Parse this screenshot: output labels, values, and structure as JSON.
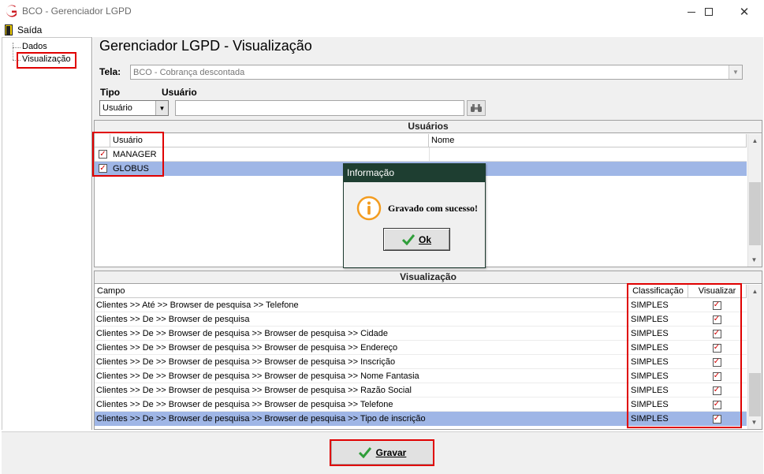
{
  "window": {
    "title": "BCO - Gerenciador LGPD",
    "minimize": "—",
    "maximize": "☐",
    "close": "✕"
  },
  "menu": {
    "exit_label": "Saída"
  },
  "tree": {
    "items": [
      {
        "label": "Dados"
      },
      {
        "label": "Visualização"
      }
    ]
  },
  "page": {
    "title": "Gerenciador LGPD - Visualização"
  },
  "form": {
    "tela_label": "Tela:",
    "tela_value": "BCO - Cobrança descontada",
    "tipo_label": "Tipo",
    "tipo_value": "Usuário",
    "usuario_label": "Usuário",
    "usuario_value": ""
  },
  "users_section": {
    "header": "Usuários",
    "columns": [
      "Usuário",
      "Nome"
    ],
    "rows": [
      {
        "usuario": "MANAGER",
        "nome": "",
        "checked": true,
        "selected": false
      },
      {
        "usuario": "GLOBUS",
        "nome": "",
        "checked": true,
        "selected": true
      }
    ]
  },
  "vis_section": {
    "header": "Visualização",
    "columns": [
      "Campo",
      "Classificação",
      "Visualizar"
    ],
    "rows": [
      {
        "campo": "Clientes >> Até  >> Browser de pesquisa >> Telefone",
        "classificacao": "SIMPLES",
        "visualizar": true
      },
      {
        "campo": "Clientes >> De >> Browser de pesquisa",
        "classificacao": "SIMPLES",
        "visualizar": true
      },
      {
        "campo": "Clientes >> De >> Browser de pesquisa >> Browser de pesquisa >> Cidade",
        "classificacao": "SIMPLES",
        "visualizar": true
      },
      {
        "campo": "Clientes >> De >> Browser de pesquisa >> Browser de pesquisa >> Endereço",
        "classificacao": "SIMPLES",
        "visualizar": true
      },
      {
        "campo": "Clientes >> De >> Browser de pesquisa >> Browser de pesquisa >> Inscrição",
        "classificacao": "SIMPLES",
        "visualizar": true
      },
      {
        "campo": "Clientes >> De >> Browser de pesquisa >> Browser de pesquisa >> Nome Fantasia",
        "classificacao": "SIMPLES",
        "visualizar": true
      },
      {
        "campo": "Clientes >> De >> Browser de pesquisa >> Browser de pesquisa >> Razão Social",
        "classificacao": "SIMPLES",
        "visualizar": true
      },
      {
        "campo": "Clientes >> De >> Browser de pesquisa >> Browser de pesquisa >> Telefone",
        "classificacao": "SIMPLES",
        "visualizar": true
      },
      {
        "campo": "Clientes >> De >> Browser de pesquisa >> Browser de pesquisa >> Tipo de inscrição",
        "classificacao": "SIMPLES",
        "visualizar": true,
        "selected": true
      }
    ]
  },
  "save_button": {
    "label": "Gravar"
  },
  "dialog": {
    "title": "Informação",
    "message": "Gravado com sucesso!",
    "ok_label": "Ok"
  },
  "icons": {
    "app": "globus-logo-icon",
    "exit": "exit-door-icon",
    "search": "binoculars-icon",
    "info": "info-icon",
    "check": "checkmark-icon"
  },
  "colors": {
    "selection": "#9fb6e6",
    "dialog_title_bg": "#1e3e31",
    "annotation": "#e00000",
    "check_mark": "#d00000",
    "ok_check": "#2f9e3a",
    "info_orange": "#f39c1f"
  }
}
